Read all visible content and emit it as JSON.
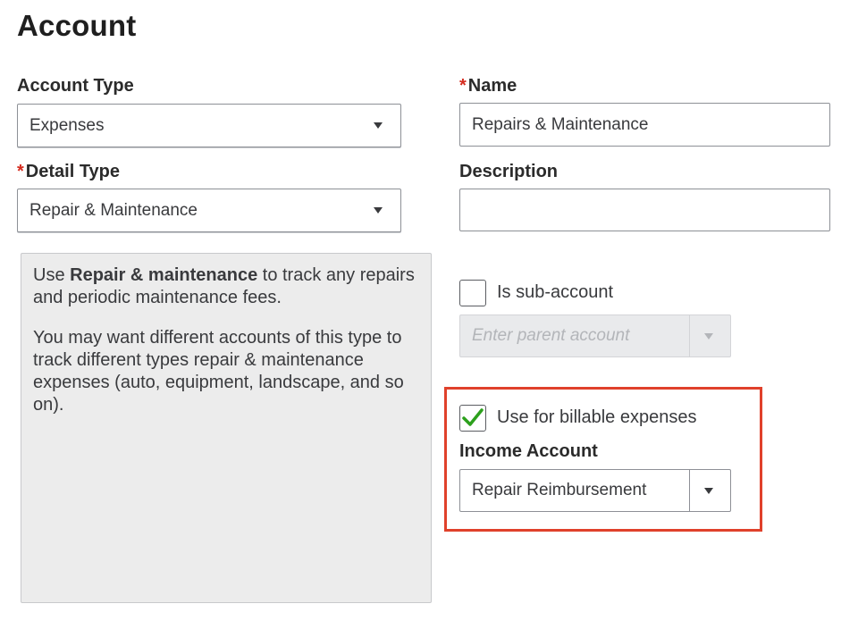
{
  "page": {
    "title": "Account"
  },
  "account_type": {
    "label": "Account Type",
    "value": "Expenses"
  },
  "detail_type": {
    "required_mark": "*",
    "label": "Detail Type",
    "value": "Repair & Maintenance"
  },
  "name": {
    "required_mark": "*",
    "label": "Name",
    "value": "Repairs & Maintenance"
  },
  "description": {
    "label": "Description",
    "value": ""
  },
  "info": {
    "p1_prefix": "Use ",
    "p1_bold": "Repair & maintenance",
    "p1_suffix": " to track any repairs and periodic maintenance fees.",
    "p2": "You may want different accounts of this type to track different types repair & maintenance expenses (auto, equipment, landscape, and so on)."
  },
  "sub_account": {
    "label": "Is sub-account",
    "checked": false,
    "parent_placeholder": "Enter parent account"
  },
  "billable": {
    "label": "Use for billable expenses",
    "checked": true
  },
  "income_account": {
    "label": "Income Account",
    "value": "Repair Reimbursement"
  },
  "colors": {
    "required": "#d52b1e",
    "check": "#2ca01c",
    "highlight": "#e0412b"
  }
}
